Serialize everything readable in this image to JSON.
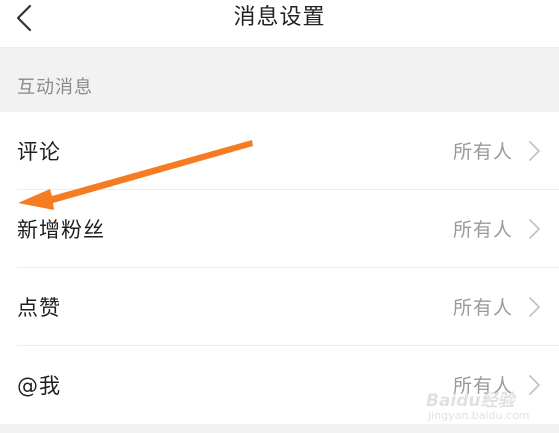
{
  "header": {
    "title": "消息设置",
    "back_icon": "chevron-left-icon"
  },
  "section": {
    "title": "互动消息"
  },
  "rows": [
    {
      "label": "评论",
      "value": "所有人",
      "icon": "chevron-right-icon"
    },
    {
      "label": "新增粉丝",
      "value": "所有人",
      "icon": "chevron-right-icon"
    },
    {
      "label": "点赞",
      "value": "所有人",
      "icon": "chevron-right-icon"
    },
    {
      "label": "@我",
      "value": "所有人",
      "icon": "chevron-right-icon"
    }
  ],
  "annotation": {
    "arrow_color": "#f57c22",
    "points_to": "新增粉丝"
  },
  "watermark": {
    "brand": "Baidu经验",
    "url": "jingyan.baidu.com"
  },
  "colors": {
    "background": "#ffffff",
    "section_background": "#f2f2f2",
    "title_text": "#222222",
    "label_text": "#1f1f1f",
    "value_text": "#9a9a9a",
    "section_text": "#8a8a8a"
  }
}
